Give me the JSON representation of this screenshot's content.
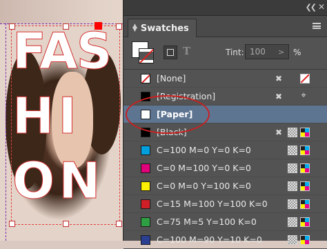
{
  "canvas": {
    "artwork_text": [
      "FAS",
      "HI",
      "ON"
    ]
  },
  "panel": {
    "title": "Swatches",
    "collapse_icon": "double-chevron-left-icon",
    "close_icon": "close-icon",
    "menu_icon": "hamburger-menu-icon",
    "tint_label": "Tint:",
    "tint_value": "100",
    "tint_arrow": ">",
    "tint_unit": "%",
    "text_toggle_label": "T"
  },
  "swatches": [
    {
      "name": "[None]",
      "color": "none",
      "icons": [
        "no-edit-icon",
        "none-mode-icon"
      ]
    },
    {
      "name": "[Registration]",
      "color": "#000000",
      "icons": [
        "no-edit-icon",
        "registration-icon"
      ]
    },
    {
      "name": "[Paper]",
      "color": "#ffffff",
      "selected": true,
      "icons": []
    },
    {
      "name": "[Black]",
      "color": "#000000",
      "icons": [
        "no-edit-icon",
        "process-color-icon",
        "cmyk-icon"
      ]
    },
    {
      "name": "C=100 M=0 Y=0 K=0",
      "color": "#00a0e0",
      "icons": [
        "process-color-icon",
        "cmyk-icon"
      ]
    },
    {
      "name": "C=0 M=100 Y=0 K=0",
      "color": "#e0007a",
      "icons": [
        "process-color-icon",
        "cmyk-icon"
      ]
    },
    {
      "name": "C=0 M=0 Y=100 K=0",
      "color": "#fff000",
      "icons": [
        "process-color-icon",
        "cmyk-icon"
      ]
    },
    {
      "name": "C=15 M=100 Y=100 K=0",
      "color": "#cf2027",
      "icons": [
        "process-color-icon",
        "cmyk-icon"
      ]
    },
    {
      "name": "C=75 M=5 Y=100 K=0",
      "color": "#2ea043",
      "icons": [
        "process-color-icon",
        "cmyk-icon"
      ]
    },
    {
      "name": "C=100 M=90 Y=10 K=0",
      "color": "#2a3f92",
      "icons": [
        "process-color-icon",
        "cmyk-icon"
      ]
    }
  ],
  "colors": {
    "panel_bg": "#535353",
    "selection": "#5e7592",
    "annotation_ellipse": "#c92020"
  }
}
